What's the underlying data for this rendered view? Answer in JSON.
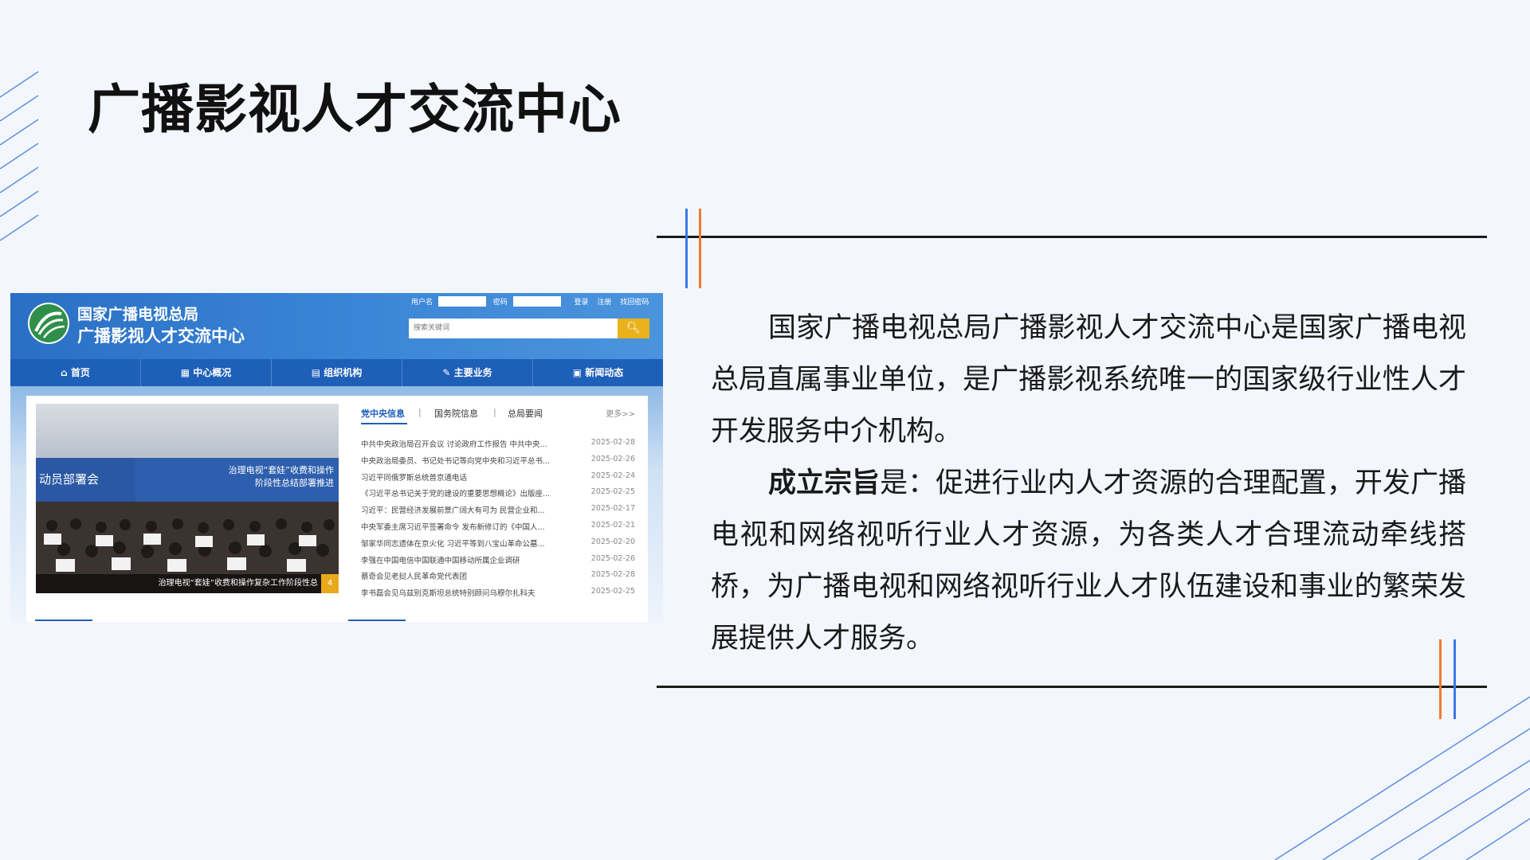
{
  "slide": {
    "title": "广播影视人才交流中心",
    "paragraph1": "国家广播电视总局广播影视人才交流中心是国家广播电视总局直属事业单位，是广播影视系统唯一的国家级行业性人才开发服务中介机构。",
    "paragraph2_bold": "成立宗旨",
    "paragraph2_rest": "是：促进行业内人才资源的合理配置，开发广播电视和网络视听行业人才资源，为各类人才合理流动牵线搭桥，为广播电视和网络视听行业人才队伍建设和事业的繁荣发展提供人才服务。",
    "accent_colors": {
      "blue": "#3b78e7",
      "orange": "#f07a2e"
    }
  },
  "website": {
    "site_name_line1": "国家广播电视总局",
    "site_name_line2": "广播影视人才交流中心",
    "login": {
      "username_label": "用户名",
      "password_label": "密码",
      "login_link": "登录",
      "register_link": "注册",
      "forgot_link": "找回密码"
    },
    "search_placeholder": "搜索关键词",
    "search_icon": "search-icon",
    "nav": [
      "首页",
      "中心概况",
      "组织机构",
      "主要业务",
      "新闻动态"
    ],
    "photo": {
      "left_text": "动员部署会",
      "banner_line1": "治理电视“套娃”收费和操作",
      "banner_line2": "阶段性总结部署推进",
      "caption": "治理电视“套娃”收费和操作复杂工作阶段性总",
      "badge": "4"
    },
    "tabs": {
      "active": "党中央信息",
      "tab2": "国务院信息",
      "tab3": "总局要闻",
      "more": "更多>>"
    },
    "news": [
      {
        "title": "中共中央政治局召开会议 讨论政府工作报告 中共中央...",
        "date": "2025-02-28"
      },
      {
        "title": "中央政治局委员、书记处书记等向党中央和习近平总书...",
        "date": "2025-02-26"
      },
      {
        "title": "习近平同俄罗斯总统普京通电话",
        "date": "2025-02-24"
      },
      {
        "title": "《习近平总书记关于党的建设的重要思想概论》出版座...",
        "date": "2025-02-25"
      },
      {
        "title": "习近平：民营经济发展前景广阔大有可为 民营企业和...",
        "date": "2025-02-17"
      },
      {
        "title": "中央军委主席习近平签署命令 发布新修订的《中国人...",
        "date": "2025-02-21"
      },
      {
        "title": "邹家华同志遗体在京火化 习近平等到八宝山革命公墓...",
        "date": "2025-02-20"
      },
      {
        "title": "李强在中国电信中国联通中国移动所属企业调研",
        "date": "2025-02-26"
      },
      {
        "title": "蔡奇会见老挝人民革命党代表团",
        "date": "2025-02-28"
      },
      {
        "title": "李书磊会见乌兹别克斯坦总统特别顾问乌穆尔扎科夫",
        "date": "2025-02-25"
      }
    ]
  }
}
